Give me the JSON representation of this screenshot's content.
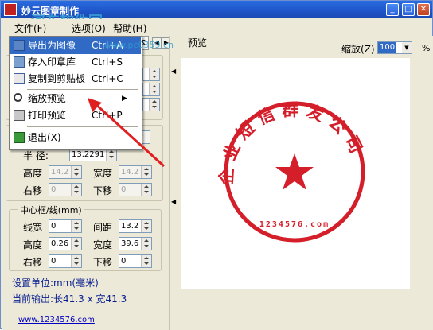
{
  "window": {
    "title": "妙云图章制作",
    "min_glyph": "_",
    "max_glyph": "□",
    "close_glyph": "✕"
  },
  "watermark": {
    "text": "河东软件园",
    "url": "www.pc0359.cn"
  },
  "menubar": {
    "items": [
      "文件(F)",
      "选项(O)",
      "帮助(H)"
    ]
  },
  "file_menu": {
    "items": [
      {
        "label": "导出为图像",
        "shortcut": "Ctrl+A"
      },
      {
        "label": "存入印章库",
        "shortcut": "Ctrl+S"
      },
      {
        "label": "复制到剪贴板",
        "shortcut": "Ctrl+C"
      },
      {
        "label": "缩放预览",
        "submenu_arrow": "▶"
      },
      {
        "label": "打印预览",
        "shortcut": "Ctrl+P"
      },
      {
        "label": "退出(X)"
      }
    ]
  },
  "tabs": {
    "partial_label": "文本",
    "prev": "◀",
    "next": "▶"
  },
  "partial_button": "行",
  "circle_group": {
    "radius_label": "半  径:",
    "radius_value": "13.2291",
    "height_label": "高度",
    "height_value": "14.2",
    "width_label": "宽度",
    "width_value": "14.2",
    "right_label": "右移",
    "right_value": "0",
    "down_label": "下移",
    "down_value": "0"
  },
  "center_group": {
    "title": "中心框/线(mm)",
    "line_width_label": "线宽",
    "line_width_value": "0",
    "spacing_label": "间距",
    "spacing_value": "13.2",
    "height_label": "高度",
    "height_value": "0.26",
    "width_label": "宽度",
    "width_value": "39.6",
    "right_label": "右移",
    "right_value": "0",
    "down_label": "下移",
    "down_value": "0"
  },
  "status": {
    "unit": "设置单位:mm(毫米)",
    "output": "当前输出:长41.3 x 宽41.3"
  },
  "footer": {
    "link": "www.1234576.com"
  },
  "preview": {
    "title": "预览",
    "zoom_label": "缩放(Z)",
    "zoom_value": "100",
    "percent": "%"
  },
  "stamp": {
    "color": "#d41e2a",
    "arc_text": "企业短信群发公司",
    "bottom_text": "1234576.com"
  }
}
